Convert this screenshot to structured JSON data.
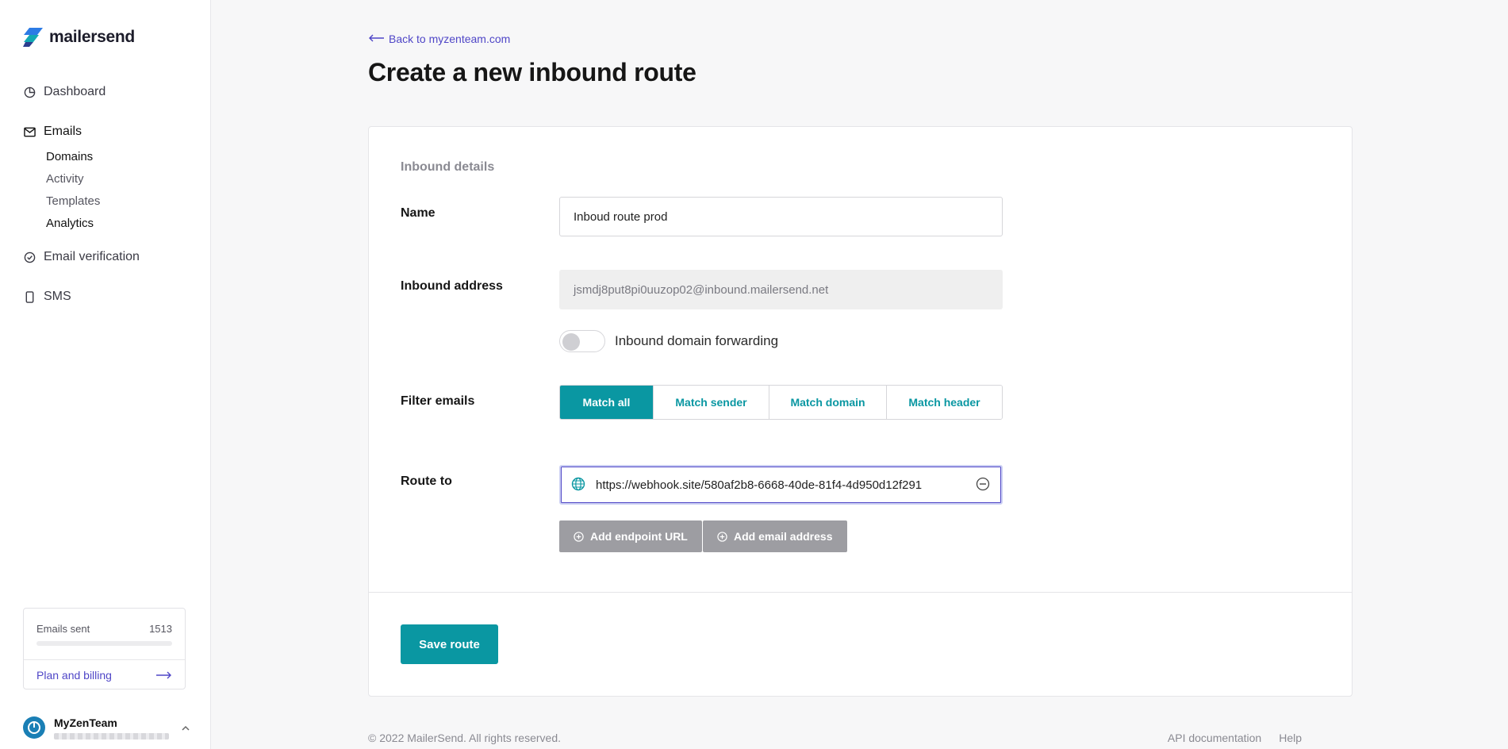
{
  "brand": {
    "name": "mailersend",
    "accent": "#0a97a2",
    "link": "#4f46c7"
  },
  "sidebar": {
    "nav": [
      {
        "label": "Dashboard",
        "icon": "dashboard-icon"
      },
      {
        "label": "Emails",
        "icon": "mail-icon"
      },
      {
        "label": "Email verification",
        "icon": "check-circle-icon"
      },
      {
        "label": "SMS",
        "icon": "phone-icon"
      }
    ],
    "email_sub": [
      "Domains",
      "Activity",
      "Templates",
      "Analytics"
    ],
    "usage": {
      "label": "Emails sent",
      "count": "1513",
      "fraction": 0.0
    },
    "billing_link": "Plan and billing",
    "account": {
      "name": "MyZenTeam"
    }
  },
  "header": {
    "back_link": "Back to myzenteam.com",
    "title": "Create a new inbound route"
  },
  "form": {
    "section_title": "Inbound details",
    "name_label": "Name",
    "name_value": "Inboud route prod",
    "address_label": "Inbound address",
    "address_value": "jsmdj8put8pi0uuzop02@inbound.mailersend.net",
    "forwarding_label": "Inbound domain forwarding",
    "forwarding_on": false,
    "filter_label": "Filter emails",
    "filter_options": [
      "Match all",
      "Match sender",
      "Match domain",
      "Match header"
    ],
    "filter_selected": "Match all",
    "route_label": "Route to",
    "route_value": "https://webhook.site/580af2b8-6668-40de-81f4-4d950d12f291",
    "add_endpoint": "Add endpoint URL",
    "add_email": "Add email address",
    "save": "Save route"
  },
  "footer": {
    "copyright": "© 2022 MailerSend. All rights reserved.",
    "links": [
      "API documentation",
      "Help"
    ]
  }
}
